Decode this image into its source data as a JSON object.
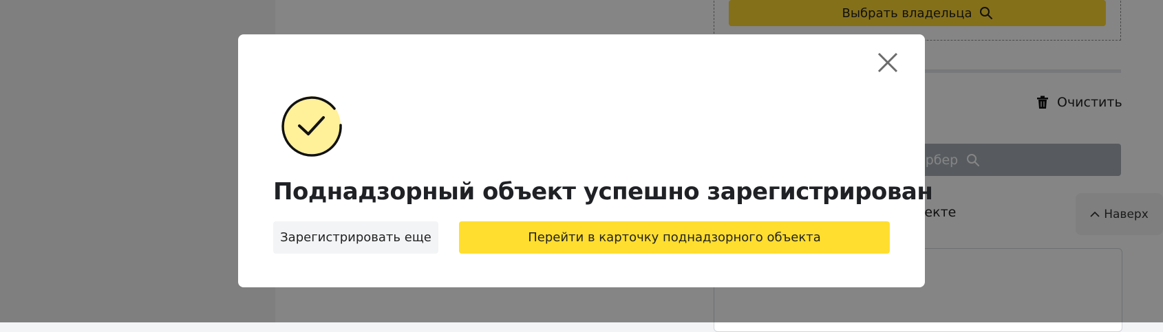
{
  "background": {
    "owner_button_label": "Выбрать владельца",
    "clear_label": "Очистить",
    "search_button_label": "ербер",
    "section_link_label": "ъекте",
    "scroll_top_label": "Наверх"
  },
  "modal": {
    "title": "Поднадзорный объект успешно зарегистрирован",
    "register_again_label": "Зарегистрировать еще",
    "go_to_card_label": "Перейти в карточку поднадзорного объекта",
    "icons": {
      "close": "close-icon",
      "success": "success-check-icon"
    }
  },
  "colors": {
    "accent_yellow": "#ffde2f",
    "success_circle": "#fff09a",
    "overlay": "rgba(0,0,0,0.48)"
  }
}
